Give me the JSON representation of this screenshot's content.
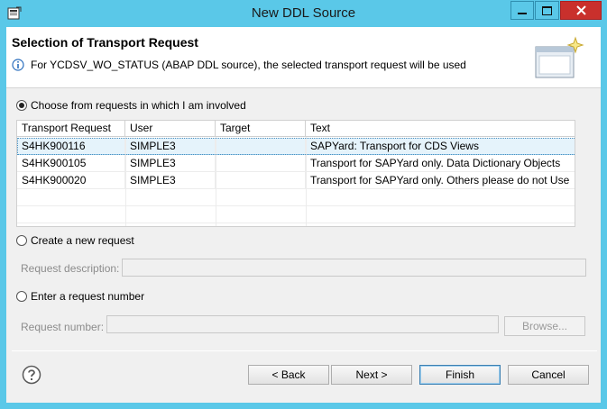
{
  "window": {
    "title": "New DDL Source"
  },
  "header": {
    "title": "Selection of Transport Request",
    "message": "For YCDSV_WO_STATUS (ABAP DDL source), the selected transport request will be used"
  },
  "options": {
    "choose_label": "Choose from requests in which I am involved",
    "create_label": "Create a new request",
    "enter_label": "Enter a request number",
    "selected": "choose"
  },
  "table": {
    "columns": [
      "Transport Request",
      "User",
      "Target",
      "Text"
    ],
    "rows": [
      {
        "request": "S4HK900116",
        "user": "SIMPLE3",
        "target": "",
        "text": "SAPYard: Transport for CDS Views"
      },
      {
        "request": "S4HK900105",
        "user": "SIMPLE3",
        "target": "",
        "text": "Transport for SAPYard only. Data Dictionary Objects"
      },
      {
        "request": "S4HK900020",
        "user": "SIMPLE3",
        "target": "",
        "text": "Transport for SAPYard only. Others please do not Use"
      }
    ],
    "selected_row": 0
  },
  "fields": {
    "request_description_label": "Request description:",
    "request_description_value": "",
    "request_number_label": "Request number:",
    "request_number_value": "",
    "browse_label": "Browse..."
  },
  "buttons": {
    "back": "< Back",
    "next": "Next >",
    "finish": "Finish",
    "cancel": "Cancel"
  },
  "colors": {
    "titlebar": "#5ac8e8",
    "close_button": "#c9302c",
    "selection": "#e5f3fb"
  }
}
